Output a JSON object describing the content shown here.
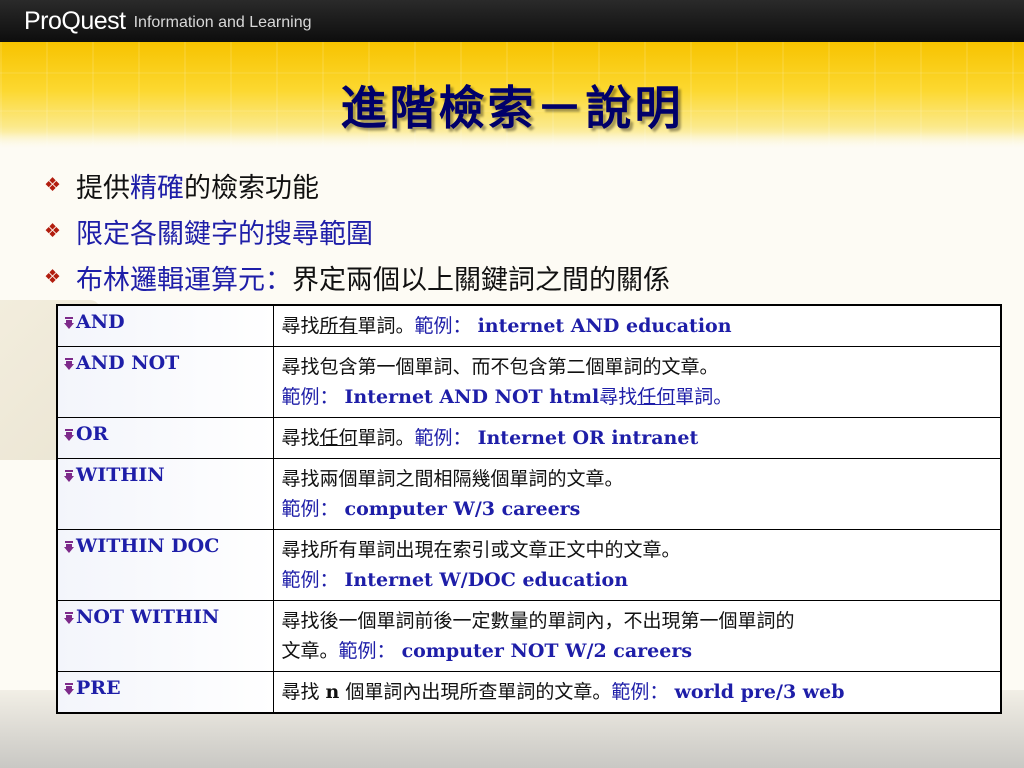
{
  "header": {
    "brand": "ProQuest",
    "brand_sub": "Information and Learning"
  },
  "title": "進階檢索－說明",
  "bullets": [
    {
      "parts": [
        {
          "t": "提供"
        },
        {
          "t": "精確",
          "c": "accent"
        },
        {
          "t": "的檢索功能"
        }
      ]
    },
    {
      "parts": [
        {
          "t": "限定各關鍵字的搜尋範圍",
          "c": "accent"
        }
      ]
    },
    {
      "parts": [
        {
          "t": "布林邏輯運算元：",
          "c": "accent"
        },
        {
          "t": "界定兩個以上關鍵詞之間的關係"
        }
      ]
    }
  ],
  "operators": [
    {
      "op": "AND",
      "lines": [
        [
          {
            "t": "尋找"
          },
          {
            "t": "所有",
            "u": true
          },
          {
            "t": "單詞。"
          },
          {
            "t": "範例： ",
            "c": "ex-label"
          },
          {
            "t": "internet AND education",
            "c": "ex-text"
          }
        ]
      ]
    },
    {
      "op": "AND NOT",
      "lines": [
        [
          {
            "t": "尋找包含第一個單詞、而不包含第二個單詞的文章。"
          }
        ],
        [
          {
            "t": "範例： ",
            "c": "ex-label"
          },
          {
            "t": "Internet AND NOT html",
            "c": "ex-text"
          },
          {
            "t": "尋找",
            "c": "ex-label"
          },
          {
            "t": "任何",
            "c": "ex-label",
            "u": true
          },
          {
            "t": "單詞。",
            "c": "ex-label"
          }
        ]
      ]
    },
    {
      "op": "OR",
      "lines": [
        [
          {
            "t": "尋找"
          },
          {
            "t": "任何",
            "u": true
          },
          {
            "t": "單詞。"
          },
          {
            "t": "範例： ",
            "c": "ex-label"
          },
          {
            "t": "Internet OR intranet",
            "c": "ex-text"
          }
        ]
      ]
    },
    {
      "op": "WITHIN",
      "lines": [
        [
          {
            "t": "尋找兩個單詞之間相隔幾個單詞的文章。"
          }
        ],
        [
          {
            "t": "範例： ",
            "c": "ex-label"
          },
          {
            "t": "computer W/3 careers",
            "c": "ex-text"
          }
        ]
      ]
    },
    {
      "op": "WITHIN DOC",
      "lines": [
        [
          {
            "t": "尋找所有單詞出現在索引或文章正文中的文章。"
          }
        ],
        [
          {
            "t": "範例： ",
            "c": "ex-label"
          },
          {
            "t": "Internet W/DOC education",
            "c": "ex-text"
          }
        ]
      ]
    },
    {
      "op": "NOT WITHIN",
      "lines": [
        [
          {
            "t": "尋找後一個單詞前後一定數量的單詞內，不出現第一個單詞的"
          }
        ],
        [
          {
            "t": "文章。"
          },
          {
            "t": "範例： ",
            "c": "ex-label"
          },
          {
            "t": "computer NOT W/2 careers",
            "c": "ex-text"
          }
        ]
      ]
    },
    {
      "op": "PRE",
      "lines": [
        [
          {
            "t": "尋找 "
          },
          {
            "t": "n",
            "c": "bold"
          },
          {
            "t": " 個單詞內出現所查單詞的文章。"
          },
          {
            "t": "範例： ",
            "c": "ex-label"
          },
          {
            "t": "world pre/3 web",
            "c": "ex-text"
          }
        ]
      ]
    }
  ],
  "colors": {
    "accent": "#1e1ea8",
    "title": "#00006a",
    "bullet_mark": "#b21d0e",
    "header_bg": "#111111",
    "band": "#fcd830"
  },
  "icons": {
    "bullet": "diamond-cluster-icon",
    "operator": "down-arrow-icon"
  }
}
